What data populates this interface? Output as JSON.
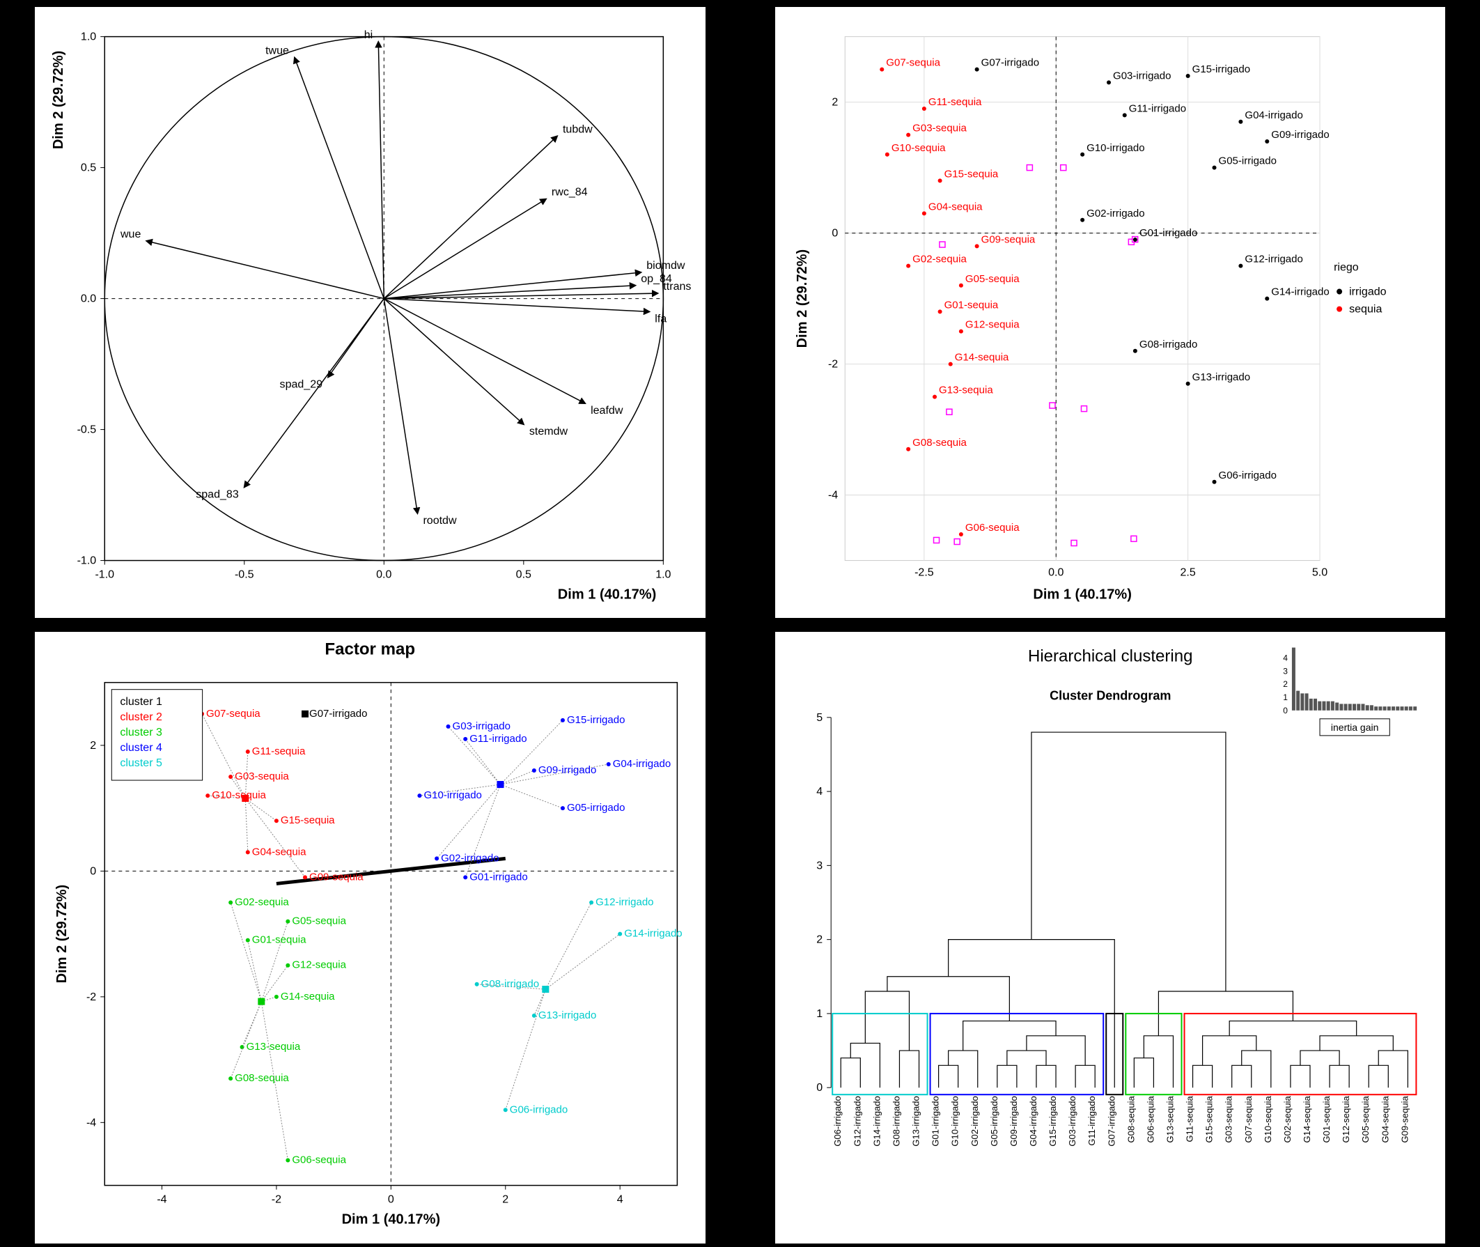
{
  "chart_data": [
    {
      "type": "biplot_variables",
      "title": "",
      "xlabel": "Dim 1 (40.17%)",
      "ylabel": "Dim 2 (29.72%)",
      "xlim": [
        -1.0,
        1.0
      ],
      "ylim": [
        -1.0,
        1.0
      ],
      "xticks": [
        -1.0,
        -0.5,
        0.0,
        0.5,
        1.0
      ],
      "yticks": [
        -1.0,
        -0.5,
        0.0,
        0.5,
        1.0
      ],
      "variables": [
        {
          "name": "twue",
          "x": -0.32,
          "y": 0.92
        },
        {
          "name": "hi",
          "x": -0.02,
          "y": 0.98
        },
        {
          "name": "tubdw",
          "x": 0.62,
          "y": 0.62
        },
        {
          "name": "rwc_84",
          "x": 0.58,
          "y": 0.38
        },
        {
          "name": "wue",
          "x": -0.85,
          "y": 0.22
        },
        {
          "name": "biomdw",
          "x": 0.92,
          "y": 0.1
        },
        {
          "name": "op_84",
          "x": 0.9,
          "y": 0.05
        },
        {
          "name": "ttrans",
          "x": 0.98,
          "y": 0.02
        },
        {
          "name": "lfa",
          "x": 0.95,
          "y": -0.05
        },
        {
          "name": "spad_29",
          "x": -0.2,
          "y": -0.3
        },
        {
          "name": "leafdw",
          "x": 0.72,
          "y": -0.4
        },
        {
          "name": "stemdw",
          "x": 0.5,
          "y": -0.48
        },
        {
          "name": "spad_83",
          "x": -0.5,
          "y": -0.72
        },
        {
          "name": "rootdw",
          "x": 0.12,
          "y": -0.82
        }
      ]
    },
    {
      "type": "scatter",
      "title": "",
      "xlabel": "Dim 1 (40.17%)",
      "ylabel": "Dim 2 (29.72%)",
      "xlim": [
        -4,
        5
      ],
      "ylim": [
        -5,
        3
      ],
      "xticks": [
        -2.5,
        0.0,
        2.5,
        5.0
      ],
      "yticks": [
        -4,
        -2,
        0,
        2
      ],
      "legend_title": "riego",
      "legend_items": [
        {
          "name": "irrigado",
          "color": "#000000"
        },
        {
          "name": "sequia",
          "color": "#ff0000"
        }
      ],
      "points": [
        {
          "label": "G07-sequia",
          "x": -3.3,
          "y": 2.5,
          "group": "sequia"
        },
        {
          "label": "G07-irrigado",
          "x": -1.5,
          "y": 2.5,
          "group": "irrigado"
        },
        {
          "label": "G03-irrigado",
          "x": 1.0,
          "y": 2.3,
          "group": "irrigado"
        },
        {
          "label": "G15-irrigado",
          "x": 2.5,
          "y": 2.4,
          "group": "irrigado"
        },
        {
          "label": "G11-sequia",
          "x": -2.5,
          "y": 1.9,
          "group": "sequia"
        },
        {
          "label": "G11-irrigado",
          "x": 1.3,
          "y": 1.8,
          "group": "irrigado"
        },
        {
          "label": "G04-irrigado",
          "x": 3.5,
          "y": 1.7,
          "group": "irrigado"
        },
        {
          "label": "G03-sequia",
          "x": -2.8,
          "y": 1.5,
          "group": "sequia"
        },
        {
          "label": "G09-irrigado",
          "x": 4.0,
          "y": 1.4,
          "group": "irrigado"
        },
        {
          "label": "G10-sequia",
          "x": -3.2,
          "y": 1.2,
          "group": "sequia"
        },
        {
          "label": "G10-irrigado",
          "x": 0.5,
          "y": 1.2,
          "group": "irrigado"
        },
        {
          "label": "G05-irrigado",
          "x": 3.0,
          "y": 1.0,
          "group": "irrigado"
        },
        {
          "label": "G15-sequia",
          "x": -2.2,
          "y": 0.8,
          "group": "sequia"
        },
        {
          "label": "G04-sequia",
          "x": -2.5,
          "y": 0.3,
          "group": "sequia"
        },
        {
          "label": "G02-irrigado",
          "x": 0.5,
          "y": 0.2,
          "group": "irrigado"
        },
        {
          "label": "G01-irrigado",
          "x": 1.5,
          "y": -0.1,
          "group": "irrigado"
        },
        {
          "label": "G09-sequia",
          "x": -1.5,
          "y": -0.2,
          "group": "sequia"
        },
        {
          "label": "G02-sequia",
          "x": -2.8,
          "y": -0.5,
          "group": "sequia"
        },
        {
          "label": "G12-irrigado",
          "x": 3.5,
          "y": -0.5,
          "group": "irrigado"
        },
        {
          "label": "G05-sequia",
          "x": -1.8,
          "y": -0.8,
          "group": "sequia"
        },
        {
          "label": "G14-irrigado",
          "x": 4.0,
          "y": -1.0,
          "group": "irrigado"
        },
        {
          "label": "G01-sequia",
          "x": -2.2,
          "y": -1.2,
          "group": "sequia"
        },
        {
          "label": "G12-sequia",
          "x": -1.8,
          "y": -1.5,
          "group": "sequia"
        },
        {
          "label": "G08-irrigado",
          "x": 1.5,
          "y": -1.8,
          "group": "irrigado"
        },
        {
          "label": "G14-sequia",
          "x": -2.0,
          "y": -2.0,
          "group": "sequia"
        },
        {
          "label": "G13-irrigado",
          "x": 2.5,
          "y": -2.3,
          "group": "irrigado"
        },
        {
          "label": "G13-sequia",
          "x": -2.3,
          "y": -2.5,
          "group": "sequia"
        },
        {
          "label": "G08-sequia",
          "x": -2.8,
          "y": -3.3,
          "group": "sequia"
        },
        {
          "label": "G06-irrigado",
          "x": 3.0,
          "y": -3.8,
          "group": "irrigado"
        },
        {
          "label": "G06-sequia",
          "x": -1.8,
          "y": -4.6,
          "group": "sequia"
        }
      ]
    },
    {
      "type": "factor_map",
      "title": "Factor map",
      "xlabel": "Dim 1 (40.17%)",
      "ylabel": "Dim 2 (29.72%)",
      "xlim": [
        -5,
        5
      ],
      "ylim": [
        -5,
        3
      ],
      "xticks": [
        -4,
        -2,
        0,
        2,
        4
      ],
      "yticks": [
        -4,
        -2,
        0,
        2
      ],
      "cluster_colors": {
        "1": "#000000",
        "2": "#ff0000",
        "3": "#00cc00",
        "4": "#0000ff",
        "5": "#00cccc"
      },
      "legend_items": [
        {
          "name": "cluster 1",
          "color": "#000000"
        },
        {
          "name": "cluster 2",
          "color": "#ff0000"
        },
        {
          "name": "cluster 3",
          "color": "#00cc00"
        },
        {
          "name": "cluster 4",
          "color": "#0000ff"
        },
        {
          "name": "cluster 5",
          "color": "#00cccc"
        }
      ],
      "points": [
        {
          "label": "G07-irrigado",
          "x": -1.5,
          "y": 2.5,
          "cluster": 1
        },
        {
          "label": "G07-sequia",
          "x": -3.3,
          "y": 2.5,
          "cluster": 2,
          "short": "sequia"
        },
        {
          "label": "G11-sequia",
          "x": -2.5,
          "y": 1.9,
          "cluster": 2
        },
        {
          "label": "G03-sequia",
          "x": -2.8,
          "y": 1.5,
          "cluster": 2,
          "short": "G03-sequia"
        },
        {
          "label": "G10-sequia",
          "x": -3.2,
          "y": 1.2,
          "cluster": 2
        },
        {
          "label": "G15-sequia",
          "x": -2.0,
          "y": 0.8,
          "cluster": 2
        },
        {
          "label": "G04-sequia",
          "x": -2.5,
          "y": 0.3,
          "cluster": 2
        },
        {
          "label": "G09-sequia",
          "x": -1.5,
          "y": -0.1,
          "cluster": 2
        },
        {
          "label": "G02-sequia",
          "x": -2.8,
          "y": -0.5,
          "cluster": 3
        },
        {
          "label": "G05-sequia",
          "x": -1.8,
          "y": -0.8,
          "cluster": 3
        },
        {
          "label": "G01-sequia",
          "x": -2.5,
          "y": -1.1,
          "cluster": 3
        },
        {
          "label": "G12-sequia",
          "x": -1.8,
          "y": -1.5,
          "cluster": 3
        },
        {
          "label": "G14-sequia",
          "x": -2.0,
          "y": -2.0,
          "cluster": 3
        },
        {
          "label": "G13-sequia",
          "x": -2.6,
          "y": -2.8,
          "cluster": 3
        },
        {
          "label": "G08-sequia",
          "x": -2.8,
          "y": -3.3,
          "cluster": 3
        },
        {
          "label": "G06-sequia",
          "x": -1.8,
          "y": -4.6,
          "cluster": 3
        },
        {
          "label": "G03-irrigado",
          "x": 1.0,
          "y": 2.3,
          "cluster": 4
        },
        {
          "label": "G15-irrigado",
          "x": 3.0,
          "y": 2.4,
          "cluster": 4
        },
        {
          "label": "G11-irrigado",
          "x": 1.3,
          "y": 2.1,
          "cluster": 4
        },
        {
          "label": "G04-irrigado",
          "x": 3.8,
          "y": 1.7,
          "cluster": 4
        },
        {
          "label": "G09-irrigado",
          "x": 2.5,
          "y": 1.6,
          "cluster": 4
        },
        {
          "label": "G10-irrigado",
          "x": 0.5,
          "y": 1.2,
          "cluster": 4
        },
        {
          "label": "G05-irrigado",
          "x": 3.0,
          "y": 1.0,
          "cluster": 4
        },
        {
          "label": "G02-irrigado",
          "x": 0.8,
          "y": 0.2,
          "cluster": 4
        },
        {
          "label": "G01-irrigado",
          "x": 1.3,
          "y": -0.1,
          "cluster": 4
        },
        {
          "label": "G12-irrigado",
          "x": 3.5,
          "y": -0.5,
          "cluster": 5
        },
        {
          "label": "G14-irrigado",
          "x": 4.0,
          "y": -1.0,
          "cluster": 5
        },
        {
          "label": "G08-irrigado",
          "x": 1.5,
          "y": -1.8,
          "cluster": 5
        },
        {
          "label": "G13-irrigado",
          "x": 2.5,
          "y": -2.3,
          "cluster": 5
        },
        {
          "label": "G06-irrigado",
          "x": 2.0,
          "y": -3.8,
          "cluster": 5
        }
      ]
    },
    {
      "type": "dendrogram",
      "title": "Hierarchical clustering",
      "subtitle": "Cluster Dendrogram",
      "ylabel": "",
      "ylim": [
        0,
        5
      ],
      "yticks": [
        0,
        1,
        2,
        3,
        4,
        5
      ],
      "inertia_legend": "inertia gain",
      "inertia_ticks": [
        0,
        1,
        2,
        3,
        4
      ],
      "cluster_boxes": [
        {
          "color": "#00cccc",
          "from": 0,
          "to": 4
        },
        {
          "color": "#0000ff",
          "from": 5,
          "to": 13
        },
        {
          "color": "#000000",
          "from": 14,
          "to": 14
        },
        {
          "color": "#00cc00",
          "from": 15,
          "to": 17
        },
        {
          "color": "#ff0000",
          "from": 18,
          "to": 29
        }
      ],
      "leaves": [
        "G06-irrigado",
        "G12-irrigado",
        "G14-irrigado",
        "G08-irrigado",
        "G13-irrigado",
        "G01-irrigado",
        "G10-irrigado",
        "G02-irrigado",
        "G05-irrigado",
        "G09-irrigado",
        "G04-irrigado",
        "G15-irrigado",
        "G03-irrigado",
        "G11-irrigado",
        "G07-irrigado",
        "G08-sequia",
        "G06-sequia",
        "G13-sequia",
        "G11-sequia",
        "G15-sequia",
        "G03-sequia",
        "G07-sequia",
        "G10-sequia",
        "G02-sequia",
        "G14-sequia",
        "G01-sequia",
        "G12-sequia",
        "G05-sequia",
        "G04-sequia",
        "G09-sequia"
      ],
      "merges": [
        {
          "left": 0,
          "right": 1,
          "height": 0.4,
          "id": "m0"
        },
        {
          "left": "m0",
          "right": 2,
          "height": 0.6,
          "id": "m1"
        },
        {
          "left": 3,
          "right": 4,
          "height": 0.5,
          "id": "m2"
        },
        {
          "left": "m1",
          "right": "m2",
          "height": 1.3,
          "id": "m3"
        },
        {
          "left": 5,
          "right": 6,
          "height": 0.3,
          "id": "m4"
        },
        {
          "left": "m4",
          "right": 7,
          "height": 0.5,
          "id": "m5"
        },
        {
          "left": 8,
          "right": 9,
          "height": 0.3,
          "id": "m6"
        },
        {
          "left": 10,
          "right": 11,
          "height": 0.3,
          "id": "m7"
        },
        {
          "left": "m6",
          "right": "m7",
          "height": 0.5,
          "id": "m8"
        },
        {
          "left": 12,
          "right": 13,
          "height": 0.3,
          "id": "m9"
        },
        {
          "left": "m8",
          "right": "m9",
          "height": 0.7,
          "id": "m10"
        },
        {
          "left": "m5",
          "right": "m10",
          "height": 0.9,
          "id": "m11"
        },
        {
          "left": "m3",
          "right": "m11",
          "height": 1.5,
          "id": "m12"
        },
        {
          "left": "m12",
          "right": 14,
          "height": 2.0,
          "id": "m13"
        },
        {
          "left": 15,
          "right": 16,
          "height": 0.4,
          "id": "m14"
        },
        {
          "left": "m14",
          "right": 17,
          "height": 0.7,
          "id": "m15"
        },
        {
          "left": 18,
          "right": 19,
          "height": 0.3,
          "id": "m16"
        },
        {
          "left": 20,
          "right": 21,
          "height": 0.3,
          "id": "m17"
        },
        {
          "left": "m17",
          "right": 22,
          "height": 0.5,
          "id": "m18"
        },
        {
          "left": "m16",
          "right": "m18",
          "height": 0.7,
          "id": "m19"
        },
        {
          "left": 23,
          "right": 24,
          "height": 0.3,
          "id": "m20"
        },
        {
          "left": 25,
          "right": 26,
          "height": 0.3,
          "id": "m21"
        },
        {
          "left": "m20",
          "right": "m21",
          "height": 0.5,
          "id": "m22"
        },
        {
          "left": 27,
          "right": 28,
          "height": 0.3,
          "id": "m23"
        },
        {
          "left": "m23",
          "right": 29,
          "height": 0.5,
          "id": "m24"
        },
        {
          "left": "m22",
          "right": "m24",
          "height": 0.7,
          "id": "m25"
        },
        {
          "left": "m19",
          "right": "m25",
          "height": 0.9,
          "id": "m26"
        },
        {
          "left": "m15",
          "right": "m26",
          "height": 1.3,
          "id": "m27"
        },
        {
          "left": "m13",
          "right": "m27",
          "height": 4.8,
          "id": "m28"
        }
      ],
      "inertia_bars": [
        4.8,
        1.5,
        1.3,
        1.3,
        0.9,
        0.9,
        0.7,
        0.7,
        0.7,
        0.7,
        0.6,
        0.5,
        0.5,
        0.5,
        0.5,
        0.5,
        0.5,
        0.4,
        0.4,
        0.3,
        0.3,
        0.3,
        0.3,
        0.3,
        0.3,
        0.3,
        0.3,
        0.3,
        0.3
      ]
    }
  ]
}
